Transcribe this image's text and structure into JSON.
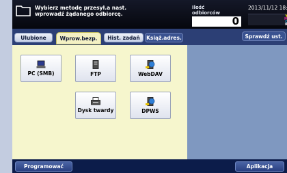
{
  "header": {
    "instruction_line1": "Wybierz metodę przesył.a nast.",
    "instruction_line2": "wprowadź żądanego odbiorcę.",
    "dest_label_line1": "Ilość",
    "dest_label_line2": "odbiorców",
    "dest_count": "0",
    "datetime": "2013/11/12 18:3",
    "toner": [
      "Y",
      "M",
      "C",
      "K"
    ]
  },
  "tabs": [
    {
      "label": "Ulubione",
      "state": "normal"
    },
    {
      "label": "Wprow.bezp.",
      "state": "active"
    },
    {
      "label": "Hist. zadań",
      "state": "normal"
    },
    {
      "label": "Książ.adres.",
      "state": "dark"
    },
    {
      "label": "Sprawdź ust.",
      "state": "dark"
    }
  ],
  "methods": [
    {
      "label": "PC (SMB)",
      "icon": "pc-icon"
    },
    {
      "label": "FTP",
      "icon": "server-icon"
    },
    {
      "label": "WebDAV",
      "icon": "webdav-server-icon"
    },
    {
      "label": "Dysk twardy",
      "icon": "hard-disk-icon"
    },
    {
      "label": "DPWS",
      "icon": "dpws-icon"
    }
  ],
  "footer": {
    "program_label": "Programować",
    "application_label": "Aplikacja"
  },
  "colors": {
    "header_bg": "#06070d",
    "tab_bar_bg": "#2c3f75",
    "content_bg": "#f6f6cd",
    "side_panel_bg": "#7f98c0",
    "footer_bg": "#0c1c4a",
    "outer_frame_bg": "#c3cce0"
  }
}
